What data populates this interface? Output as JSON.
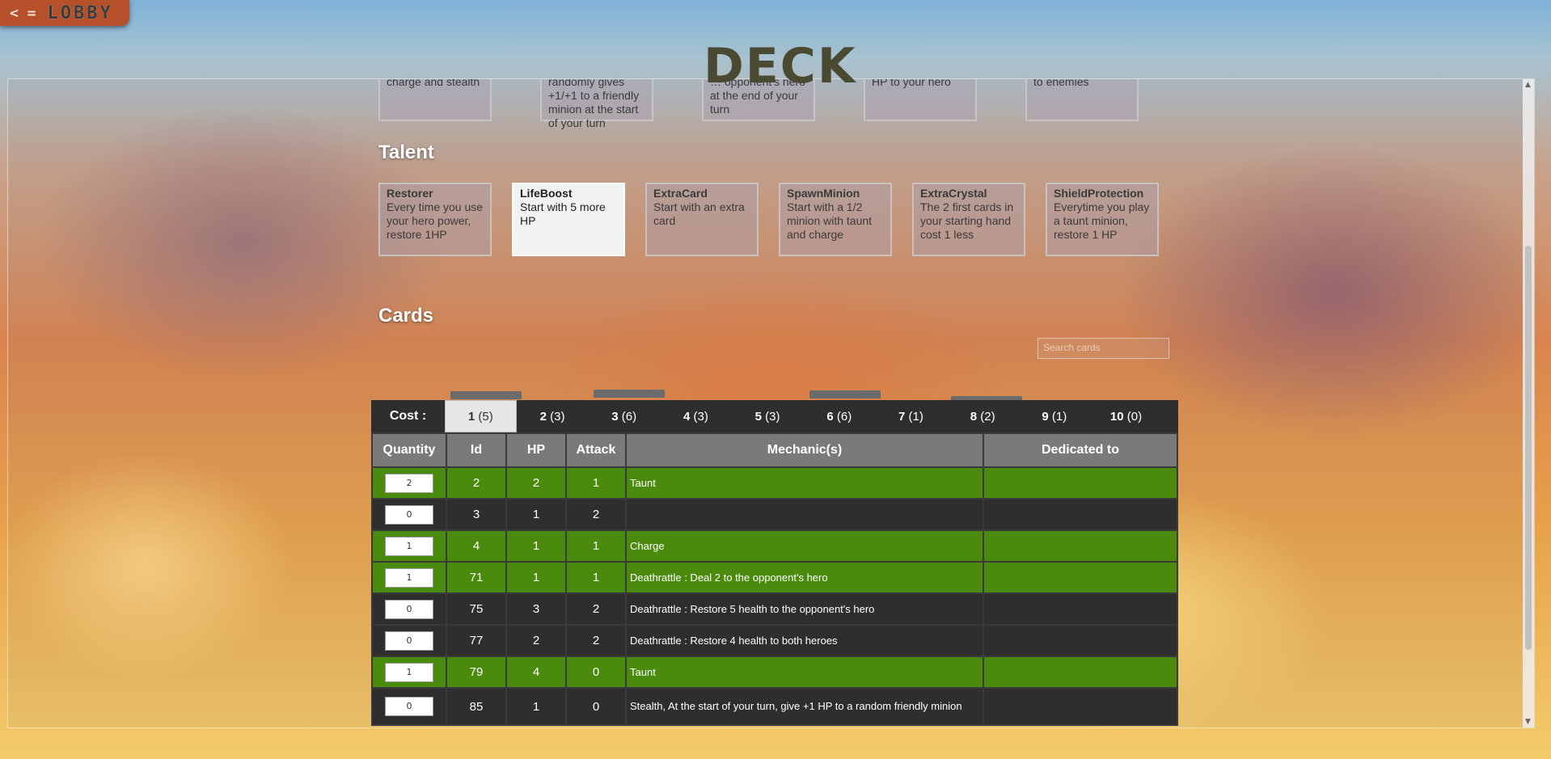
{
  "nav": {
    "back_arrow": "< =",
    "lobby_label": "LOBBY"
  },
  "page_title": "DECK",
  "top_cards": [
    {
      "text": "charge and stealth"
    },
    {
      "text": "randomly gives +1/+1 to a friendly minion at the start of your turn"
    },
    {
      "text": "… opponent's hero at the end of your turn"
    },
    {
      "text": "HP to your hero"
    },
    {
      "text": "to enemies"
    }
  ],
  "talent": {
    "title": "Talent",
    "items": [
      {
        "name": "Restorer",
        "desc": "Every time you use your hero power, restore 1HP",
        "selected": false
      },
      {
        "name": "LifeBoost",
        "desc": "Start with 5 more HP",
        "selected": true
      },
      {
        "name": "ExtraCard",
        "desc": "Start with an extra card",
        "selected": false
      },
      {
        "name": "SpawnMinion",
        "desc": "Start with a 1/2 minion with taunt and charge",
        "selected": false
      },
      {
        "name": "ExtraCrystal",
        "desc": "The 2 first cards in your starting hand cost 1 less",
        "selected": false
      },
      {
        "name": "ShieldProtection",
        "desc": "Everytime you play a taunt minion, restore 1 HP",
        "selected": false
      }
    ]
  },
  "cards": {
    "title": "Cards",
    "search_placeholder": "Search cards",
    "cost_label": "Cost :",
    "cost_tabs": [
      {
        "cost": "1",
        "count": "(5)",
        "active": true
      },
      {
        "cost": "2",
        "count": "(3)"
      },
      {
        "cost": "3",
        "count": "(6)"
      },
      {
        "cost": "4",
        "count": "(3)"
      },
      {
        "cost": "5",
        "count": "(3)"
      },
      {
        "cost": "6",
        "count": "(6)"
      },
      {
        "cost": "7",
        "count": "(1)"
      },
      {
        "cost": "8",
        "count": "(2)"
      },
      {
        "cost": "9",
        "count": "(1)"
      },
      {
        "cost": "10",
        "count": "(0)"
      }
    ],
    "columns": [
      "Quantity",
      "Id",
      "HP",
      "Attack",
      "Mechanic(s)",
      "Dedicated to"
    ],
    "rows": [
      {
        "qty": "2",
        "id": "2",
        "hp": "2",
        "attack": "1",
        "mechanic": "Taunt",
        "dedicated": "",
        "in_deck": true
      },
      {
        "qty": "0",
        "id": "3",
        "hp": "1",
        "attack": "2",
        "mechanic": "",
        "dedicated": "",
        "in_deck": false
      },
      {
        "qty": "1",
        "id": "4",
        "hp": "1",
        "attack": "1",
        "mechanic": "Charge",
        "dedicated": "",
        "in_deck": true
      },
      {
        "qty": "1",
        "id": "71",
        "hp": "1",
        "attack": "1",
        "mechanic": "Deathrattle : Deal 2 to the opponent's hero",
        "dedicated": "",
        "in_deck": true
      },
      {
        "qty": "0",
        "id": "75",
        "hp": "3",
        "attack": "2",
        "mechanic": "Deathrattle : Restore 5 health to the opponent's hero",
        "dedicated": "",
        "in_deck": false
      },
      {
        "qty": "0",
        "id": "77",
        "hp": "2",
        "attack": "2",
        "mechanic": "Deathrattle : Restore 4 health to both heroes",
        "dedicated": "",
        "in_deck": false
      },
      {
        "qty": "1",
        "id": "79",
        "hp": "4",
        "attack": "0",
        "mechanic": "Taunt",
        "dedicated": "",
        "in_deck": true
      },
      {
        "qty": "0",
        "id": "85",
        "hp": "1",
        "attack": "0",
        "mechanic": "Stealth, At the start of your turn, give +1 HP to a random friendly minion",
        "dedicated": "",
        "in_deck": false
      }
    ]
  },
  "colors": {
    "in_deck_row": "#4a8a0c",
    "row": "#2e2e2e",
    "header": "#7a7a7a",
    "lobby": "#b5502a"
  }
}
